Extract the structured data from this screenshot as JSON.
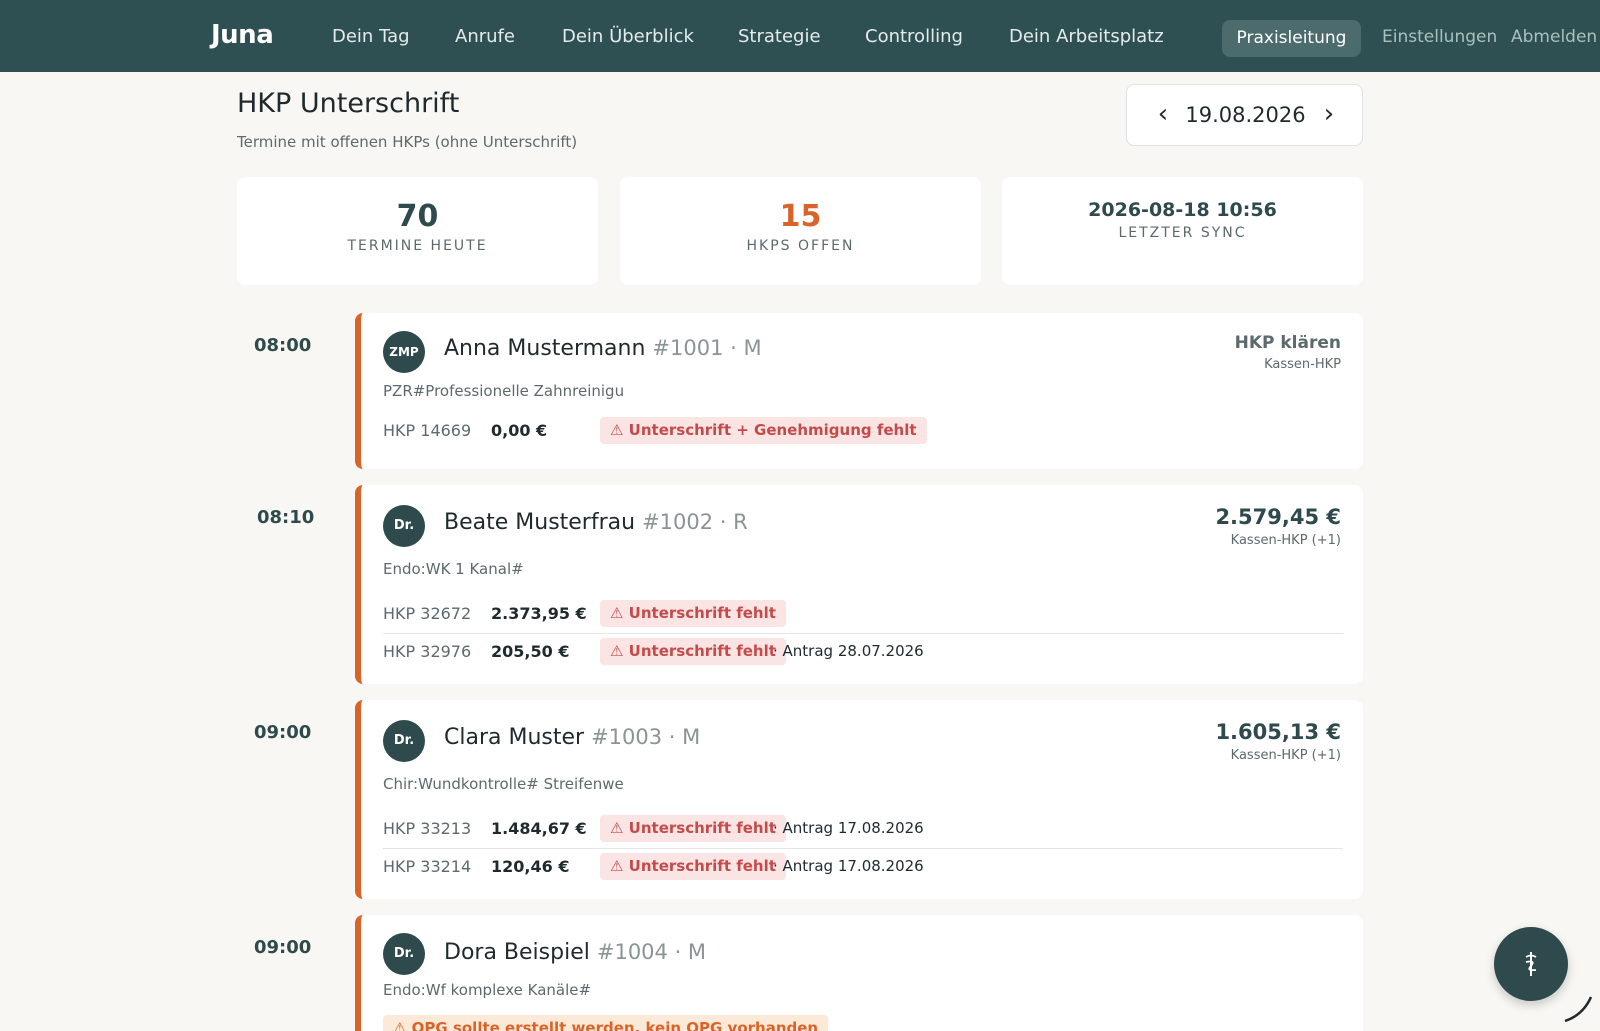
{
  "nav": {
    "logo": "Juna",
    "items": [
      "Dein Tag",
      "Anrufe",
      "Dein Überblick",
      "Strategie",
      "Controlling",
      "Dein Arbeitsplatz"
    ],
    "active": "Praxisleitung",
    "settings": "Einstellungen",
    "logout": "Abmelden"
  },
  "header": {
    "title": "HKP Unterschrift",
    "subtitle": "Termine mit offenen HKPs (ohne Unterschrift)",
    "date": "19.08.2026",
    "prev": "‹",
    "next": "›"
  },
  "stats": [
    {
      "value": "70",
      "label": "TERMINE HEUTE"
    },
    {
      "value": "15",
      "label": "HKPS OFFEN"
    },
    {
      "value": "2026-08-18 10:56",
      "label": "LETZTER SYNC"
    }
  ],
  "appointments": [
    {
      "time": "08:00",
      "avatar": "ZMP",
      "name": "Anna Mustermann",
      "meta": "#1001 · M",
      "treatment": "PZR#Professionelle Zahnreinigu",
      "right_main": "HKP klären",
      "right_sub": "Kassen-HKP",
      "hkps": [
        {
          "id": "HKP 14669",
          "amount": "0,00 €",
          "badge": "⚠ Unterschrift + Genehmigung fehlt",
          "antrag": ""
        }
      ]
    },
    {
      "time": "08:10",
      "avatar": "Dr.",
      "name": "Beate Musterfrau",
      "meta": "#1002 · R",
      "treatment": "Endo:WK 1 Kanal#",
      "right_main": "2.579,45 €",
      "right_sub": "Kassen-HKP (+1)",
      "hkps": [
        {
          "id": "HKP 32672",
          "amount": "2.373,95 €",
          "badge": "⚠ Unterschrift fehlt",
          "antrag": ""
        },
        {
          "id": "HKP 32976",
          "amount": "205,50 €",
          "badge": "⚠ Unterschrift fehlt",
          "antrag": "· Antrag 28.07.2026"
        }
      ]
    },
    {
      "time": "09:00",
      "avatar": "Dr.",
      "name": "Clara Muster",
      "meta": "#1003 · M",
      "treatment": "Chir:Wundkontrolle# Streifenwe",
      "right_main": "1.605,13 €",
      "right_sub": "Kassen-HKP (+1)",
      "hkps": [
        {
          "id": "HKP 33213",
          "amount": "1.484,67 €",
          "badge": "⚠ Unterschrift fehlt",
          "antrag": "· Antrag 17.08.2026"
        },
        {
          "id": "HKP 33214",
          "amount": "120,46 €",
          "badge": "⚠ Unterschrift fehlt",
          "antrag": "· Antrag 17.08.2026"
        }
      ]
    },
    {
      "time": "09:00",
      "avatar": "Dr.",
      "name": "Dora Beispiel",
      "meta": "#1004 · M",
      "treatment": "Endo:Wf komplexe Kanäle#",
      "warning": "⚠ OPG sollte erstellt werden, kein OPG vorhanden"
    }
  ],
  "colors": {
    "nav": "#2e5053",
    "accent": "#d9642a",
    "badge_bg": "#fbe4e4",
    "badge_text": "#c54b4b"
  },
  "fab_icon": "caduceus-icon"
}
